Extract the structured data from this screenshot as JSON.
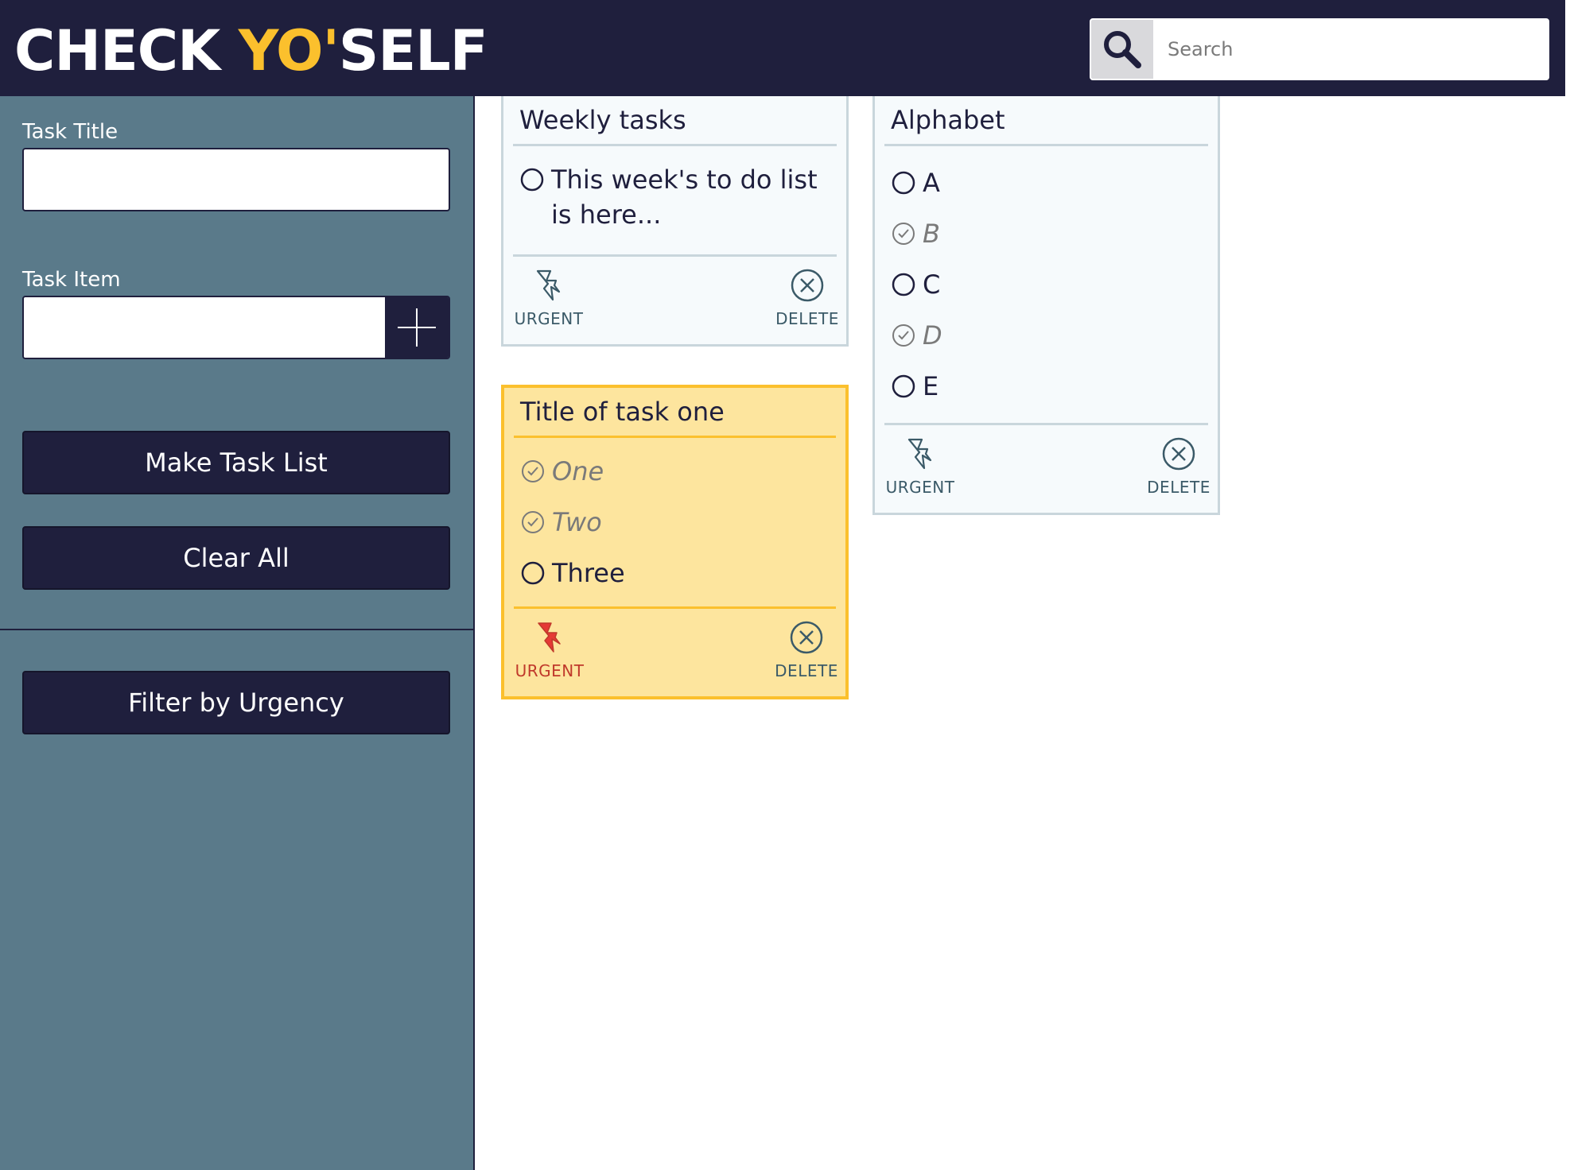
{
  "header": {
    "logo_part1": "CHECK ",
    "logo_accent": "YO'",
    "logo_part2": "SELF",
    "search_placeholder": "Search",
    "search_icon": "magnifier-icon"
  },
  "sidebar": {
    "task_title_label": "Task Title",
    "task_title_value": "",
    "task_item_label": "Task Item",
    "task_item_value": "",
    "add_icon": "plus-icon",
    "make_task_list_label": "Make Task List",
    "clear_all_label": "Clear All",
    "filter_label": "Filter by Urgency"
  },
  "cards": [
    {
      "title": "Weekly tasks",
      "urgent": false,
      "items": [
        {
          "text": "This week's to do list is here...",
          "done": false
        }
      ],
      "urgent_label": "URGENT",
      "delete_label": "DELETE"
    },
    {
      "title": "Title of task one",
      "urgent": true,
      "items": [
        {
          "text": "One",
          "done": true
        },
        {
          "text": "Two",
          "done": true
        },
        {
          "text": "Three",
          "done": false
        }
      ],
      "urgent_label": "URGENT",
      "delete_label": "DELETE"
    },
    {
      "title": "Alphabet",
      "urgent": false,
      "items": [
        {
          "text": "A",
          "done": false
        },
        {
          "text": "B",
          "done": true
        },
        {
          "text": "C",
          "done": false
        },
        {
          "text": "D",
          "done": true
        },
        {
          "text": "E",
          "done": false
        }
      ],
      "urgent_label": "URGENT",
      "delete_label": "DELETE"
    }
  ],
  "colors": {
    "navy": "#1f1f3d",
    "accent": "#fbc02d",
    "sidebar": "#5a7a8a",
    "urgent_card": "#fde59e",
    "urgent_red": "#e53935"
  }
}
